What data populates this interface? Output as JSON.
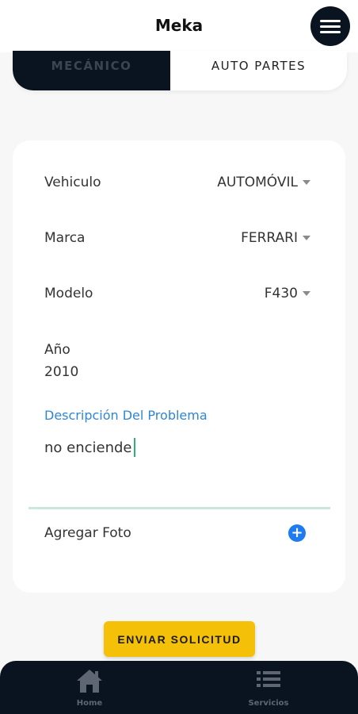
{
  "header": {
    "title": "Meka",
    "menu_icon": "hamburger-menu-icon"
  },
  "segment": {
    "left_label": "MECÁNICO",
    "right_label": "AUTO PARTES",
    "selected": "left"
  },
  "form": {
    "vehiculo": {
      "label": "Vehiculo",
      "value": "AUTOMÓVIL"
    },
    "marca": {
      "label": "Marca",
      "value": "FERRARI"
    },
    "modelo": {
      "label": "Modelo",
      "value": "F430"
    },
    "ano": {
      "label": "Año",
      "value": "2010"
    },
    "descripcion": {
      "label": "Descripción Del Problema",
      "value": "no enciende"
    },
    "foto": {
      "label": "Agregar Foto",
      "icon": "add-circle-icon"
    }
  },
  "submit_label": "ENVIAR SOLICITUD",
  "bottom_nav": [
    {
      "label": "Home",
      "icon": "home-icon"
    },
    {
      "label": "Servicios",
      "icon": "list-icon"
    }
  ],
  "colors": {
    "dark": "#0a1420",
    "accent": "#f5c008",
    "link_blue": "#2f86d6",
    "add_blue": "#1e7cf0",
    "focus_line": "#c9e7dc"
  }
}
